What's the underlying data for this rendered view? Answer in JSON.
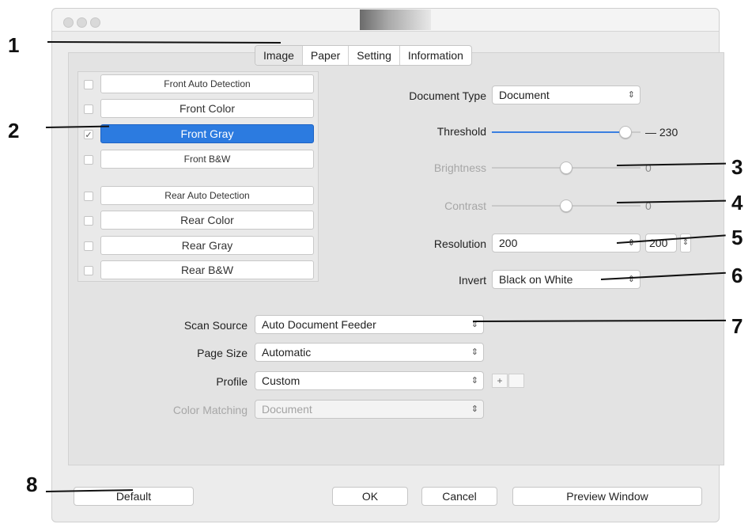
{
  "tabs": [
    "Image",
    "Paper",
    "Setting",
    "Information"
  ],
  "list": {
    "front": [
      {
        "label": "Front Auto Detection",
        "checked": false,
        "selected": false
      },
      {
        "label": "Front Color",
        "checked": false,
        "selected": false
      },
      {
        "label": "Front Gray",
        "checked": true,
        "selected": true
      },
      {
        "label": "Front B&W",
        "checked": false,
        "selected": false
      }
    ],
    "rear": [
      {
        "label": "Rear Auto Detection",
        "checked": false,
        "selected": false
      },
      {
        "label": "Rear Color",
        "checked": false,
        "selected": false
      },
      {
        "label": "Rear Gray",
        "checked": false,
        "selected": false
      },
      {
        "label": "Rear B&W",
        "checked": false,
        "selected": false
      }
    ],
    "checkmark": "✓"
  },
  "settings": {
    "document_type": {
      "label": "Document Type",
      "value": "Document"
    },
    "threshold": {
      "label": "Threshold",
      "value": "230",
      "level": 0.9
    },
    "brightness": {
      "label": "Brightness",
      "value": "0",
      "level": 0.5
    },
    "contrast": {
      "label": "Contrast",
      "value": "0",
      "level": 0.5
    },
    "resolution": {
      "label": "Resolution",
      "value": "200",
      "value2": "200"
    },
    "invert": {
      "label": "Invert",
      "value": "Black on White"
    }
  },
  "source": {
    "scan_source": {
      "label": "Scan Source",
      "value": "Auto Document Feeder"
    },
    "page_size": {
      "label": "Page Size",
      "value": "Automatic"
    },
    "profile": {
      "label": "Profile",
      "value": "Custom",
      "add": "+",
      "remove": ""
    },
    "color_matching": {
      "label": "Color Matching",
      "value": "Document"
    }
  },
  "buttons": {
    "default": "Default",
    "ok": "OK",
    "cancel": "Cancel",
    "preview": "Preview Window"
  },
  "callouts": [
    "1",
    "2",
    "3",
    "4",
    "5",
    "6",
    "7",
    "8"
  ],
  "colors": {
    "selection": "#2c7be0",
    "slider_fill": "#3a7fe0"
  }
}
